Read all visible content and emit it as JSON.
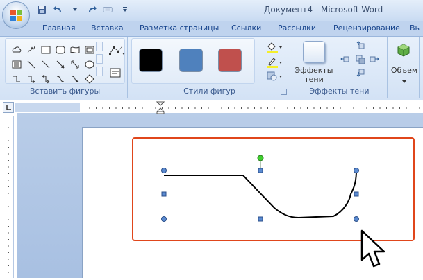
{
  "window": {
    "title": "Документ4 - Microsoft Word"
  },
  "tabs": [
    {
      "label": "Главная"
    },
    {
      "label": "Вставка"
    },
    {
      "label": "Разметка страницы"
    },
    {
      "label": "Ссылки"
    },
    {
      "label": "Рассылки"
    },
    {
      "label": "Рецензирование"
    },
    {
      "label": "Вь"
    }
  ],
  "ribbon": {
    "insert_shapes": {
      "label": "Вставить фигуры"
    },
    "shape_styles": {
      "label": "Стили фигур",
      "swatches": [
        "#000000",
        "#4f81bd",
        "#c0504d"
      ]
    },
    "shadow_effects": {
      "label": "Эффекты тени",
      "button_line1": "Эффекты",
      "button_line2": "тени"
    },
    "volume": {
      "button_label": "Объем"
    }
  },
  "colors": {
    "accent": "#e0461b",
    "ribbon": "#d3e2f5",
    "tab_text": "#15428b"
  }
}
